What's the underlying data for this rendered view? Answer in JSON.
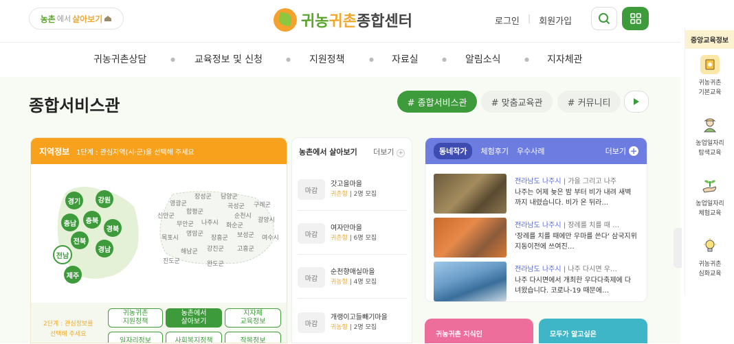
{
  "header": {
    "pill_logo": {
      "g": "농촌",
      "s": "에서",
      "o": "살아보기"
    },
    "brand": {
      "g": "귀농",
      "o": "귀촌",
      "rest": "종합센터"
    },
    "login": "로그인",
    "signup": "회원가입"
  },
  "nav": [
    "귀농귀촌상담",
    "교육정보 및 신청",
    "지원정책",
    "자료실",
    "알림소식",
    "지자체관"
  ],
  "page_title": "종합서비스관",
  "tabs": [
    "# 종합서비스관",
    "# 맞춤교육관",
    "# 커뮤니티"
  ],
  "region_panel": {
    "title": "지역정보",
    "step1": "1단계 : 관심지역(시·군)을 선택해 주세요",
    "regions": [
      "경기",
      "강원",
      "충남",
      "충북",
      "경북",
      "전북",
      "경남",
      "전남",
      "제주"
    ],
    "counties": [
      "장성군",
      "담양군",
      "영광군",
      "곡성군",
      "구례군",
      "함평군",
      "순천시",
      "신안군",
      "광양시",
      "무안군",
      "나주시",
      "화순군",
      "목포시",
      "영암군",
      "보성군",
      "여수시",
      "해남군",
      "장흥군",
      "고흥군",
      "강진군",
      "진도군",
      "완도군"
    ],
    "step2_line1": "2단계 : 관심정보를",
    "step2_line2": "선택해 주세요",
    "buttons": [
      [
        "귀농귀촌",
        "지원정책"
      ],
      [
        "농촌에서",
        "살아보기"
      ],
      [
        "지자체",
        "교육정보"
      ],
      [
        "일자리정보"
      ],
      [
        "사회복지정책"
      ],
      [
        "작목정보"
      ]
    ]
  },
  "village_panel": {
    "title": "농촌에서 살아보기",
    "more": "더보기",
    "items": [
      {
        "status": "마감",
        "name": "갓고을마을",
        "type": "귀촌형",
        "count": "2명 모집"
      },
      {
        "status": "마감",
        "name": "여자만마을",
        "type": "귀촌형",
        "count": "6명 모집"
      },
      {
        "status": "마감",
        "name": "순천향매실마을",
        "type": "귀농형",
        "count": "4명 모집"
      },
      {
        "status": "마감",
        "name": "개랭이고들빼기마을",
        "type": "귀농형",
        "count": "2명 모집"
      }
    ]
  },
  "news_panel": {
    "tabs": [
      "동네작가",
      "체험후기",
      "우수사례"
    ],
    "more": "더보기",
    "items": [
      {
        "loc": "전라남도 나주시",
        "subject": "가을 그리고 나주",
        "text": "나주는 어제 늦은 밤 부터 비가 내려 새벽까지 내렸습니다. 비가 온 뒤라…"
      },
      {
        "loc": "전라남도 나주시",
        "subject": "장례를 치를 때 …",
        "text": "'장례를 치를 때에만 우마를 쓴다' 삼국지위지동이전에 쓰여진…"
      },
      {
        "loc": "전라남도 나주시",
        "subject": "나주 다시면 우…",
        "text": "나주 다시면에서 개최한 우다다축제에 다녀왔습니다. 코로나-19 때문에…"
      }
    ]
  },
  "banners": [
    "귀농귀촌 지식인",
    "모두가 알고싶은"
  ],
  "sidebar": {
    "title": "중앙교육정보",
    "items": [
      [
        "귀농귀촌",
        "기본교육"
      ],
      [
        "농업일자리",
        "탐색교육"
      ],
      [
        "농업일자리",
        "체험교육"
      ],
      [
        "귀농귀촌",
        "심화교육"
      ]
    ]
  },
  "colors": {
    "green": "#3e9b3b",
    "orange": "#f7a11d",
    "purple": "#6c7ce0",
    "pink": "#ee6e9b",
    "teal": "#3fb6c8"
  }
}
